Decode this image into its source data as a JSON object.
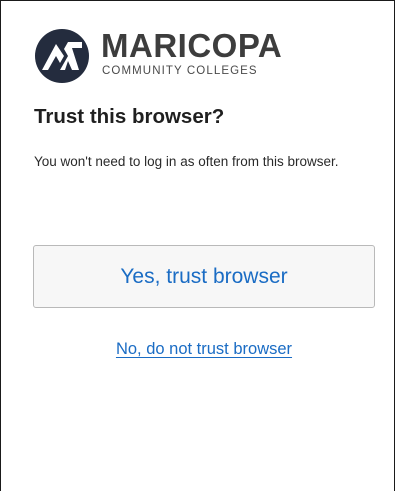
{
  "brand": {
    "name": "MARICOPA",
    "subtitle": "COMMUNITY COLLEGES",
    "logo_icon": "maricopa-logo-icon",
    "colors": {
      "mark_dark": "#242c3e",
      "text": "#3d3d3d"
    }
  },
  "prompt": {
    "heading": "Trust this browser?",
    "description": "You won't need to log in as often from this browser."
  },
  "actions": {
    "trust_label": "Yes, trust browser",
    "deny_label": "No, do not trust browser"
  },
  "colors": {
    "link": "#1a6cc4",
    "button_bg": "#f7f7f7",
    "button_border": "#b9b9b9"
  }
}
